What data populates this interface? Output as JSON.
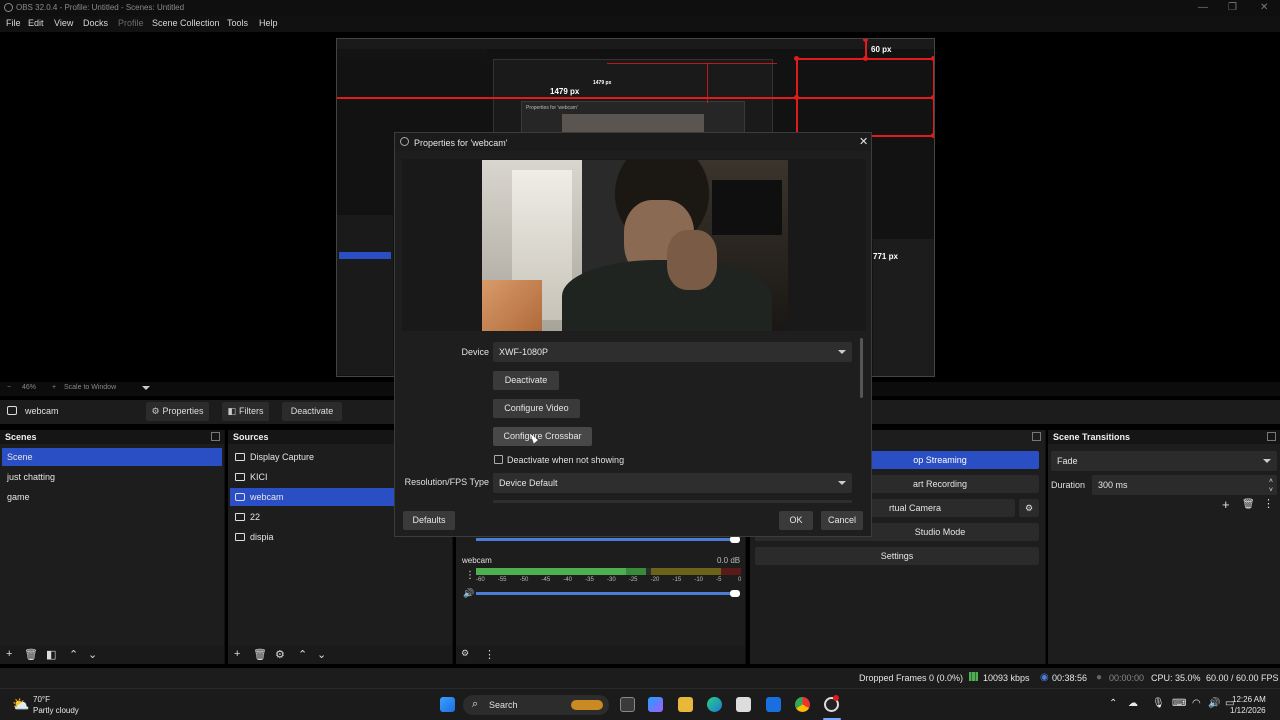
{
  "window": {
    "title": "OBS 32.0.4 - Profile: Untitled - Scenes: Untitled"
  },
  "menu": {
    "items": [
      "File",
      "Edit",
      "View",
      "Docks",
      "Profile",
      "Scene Collection",
      "Tools",
      "Help"
    ]
  },
  "preview_overlay": {
    "label_width": "1479 px",
    "label_top": "60 px",
    "label_right": "771 px",
    "nested_label_width": "1479 px",
    "nested_dialog_title": "Properties for 'webcam'"
  },
  "zoom": {
    "minus": "−",
    "level": "46%",
    "plus": "+",
    "mode": "Scale to Window"
  },
  "source_toolbar": {
    "selected_source": "webcam",
    "properties": "Properties",
    "filters": "Filters",
    "deactivate": "Deactivate"
  },
  "scenes": {
    "title": "Scenes",
    "items": [
      {
        "label": "Scene",
        "selected": true
      },
      {
        "label": "just chatting",
        "selected": false
      },
      {
        "label": "game",
        "selected": false
      }
    ]
  },
  "sources": {
    "title": "Sources",
    "items": [
      {
        "label": "Display Capture",
        "icon": "monitor-icon",
        "selected": false
      },
      {
        "label": "KICI",
        "icon": "browser-icon",
        "selected": false
      },
      {
        "label": "webcam",
        "icon": "camera-icon",
        "selected": true
      },
      {
        "label": "22",
        "icon": "image-icon",
        "selected": false
      },
      {
        "label": "dispia",
        "icon": "monitor-icon",
        "selected": false
      }
    ]
  },
  "mixer": {
    "channel": "webcam",
    "level": "0.0 dB",
    "ticks": [
      "-60",
      "-55",
      "-50",
      "-45",
      "-40",
      "-35",
      "-30",
      "-25",
      "-20",
      "-15",
      "-10",
      "-5",
      "0"
    ]
  },
  "controls": {
    "start_streaming": "op Streaming",
    "start_recording": "art Recording",
    "virtual_camera": "rtual Camera",
    "studio_mode": "Studio Mode",
    "settings": "Settings"
  },
  "transitions": {
    "title": "Scene Transitions",
    "selected": "Fade",
    "duration_label": "Duration",
    "duration_value": "300 ms"
  },
  "status": {
    "dropped_frames": "Dropped Frames 0 (0.0%)",
    "bitrate": "10093 kbps",
    "stream_time": "00:38:56",
    "record_time": "00:00:00",
    "cpu": "CPU: 35.0%",
    "fps": "60.00 / 60.00 FPS"
  },
  "taskbar": {
    "weather_temp": "70°F",
    "weather_desc": "Partly cloudy",
    "search": "Search",
    "time": "12:26 AM",
    "date": "1/12/2026"
  },
  "dialog": {
    "title": "Properties for 'webcam'",
    "device_label": "Device",
    "device_value": "XWF-1080P",
    "deactivate": "Deactivate",
    "configure_video": "Configure Video",
    "configure_crossbar": "Configure Crossbar",
    "deactivate_when_hidden": "Deactivate when not showing",
    "resolution_label": "Resolution/FPS Type",
    "resolution_value": "Device Default",
    "defaults": "Defaults",
    "ok": "OK",
    "cancel": "Cancel"
  },
  "colors": {
    "accent": "#2a4fc5",
    "guide_red": "#e21a1a",
    "meter_green": "#4caf50",
    "meter_yellow": "#c8b01e",
    "meter_red": "#b5241b"
  }
}
